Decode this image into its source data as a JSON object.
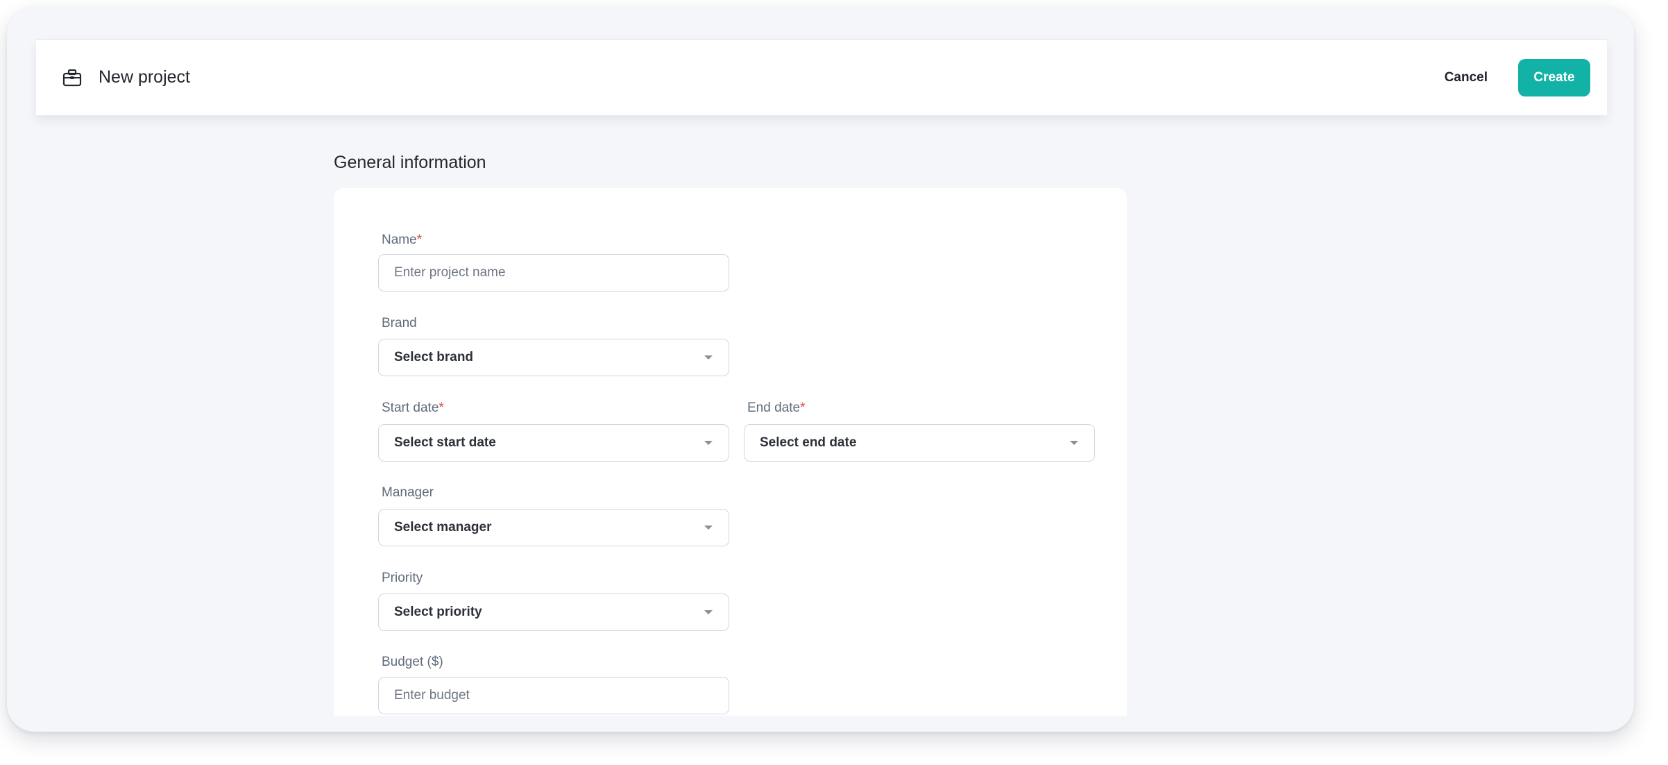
{
  "header": {
    "title": "New project",
    "icon": "briefcase-icon",
    "cancel_label": "Cancel",
    "create_label": "Create"
  },
  "section": {
    "title": "General information"
  },
  "form": {
    "name": {
      "label": "Name",
      "required_mark": "*",
      "placeholder": "Enter project name"
    },
    "brand": {
      "label": "Brand",
      "value": "Select brand"
    },
    "start_date": {
      "label": "Start date",
      "required_mark": "*",
      "value": "Select start date"
    },
    "end_date": {
      "label": "End date",
      "required_mark": "*",
      "value": "Select end date"
    },
    "manager": {
      "label": "Manager",
      "value": "Select manager"
    },
    "priority": {
      "label": "Priority",
      "value": "Select priority"
    },
    "budget": {
      "label": "Budget ($)",
      "placeholder": "Enter budget"
    }
  },
  "colors": {
    "accent": "#13b2a6",
    "required": "#e5484d",
    "background": "#f5f6fa"
  }
}
